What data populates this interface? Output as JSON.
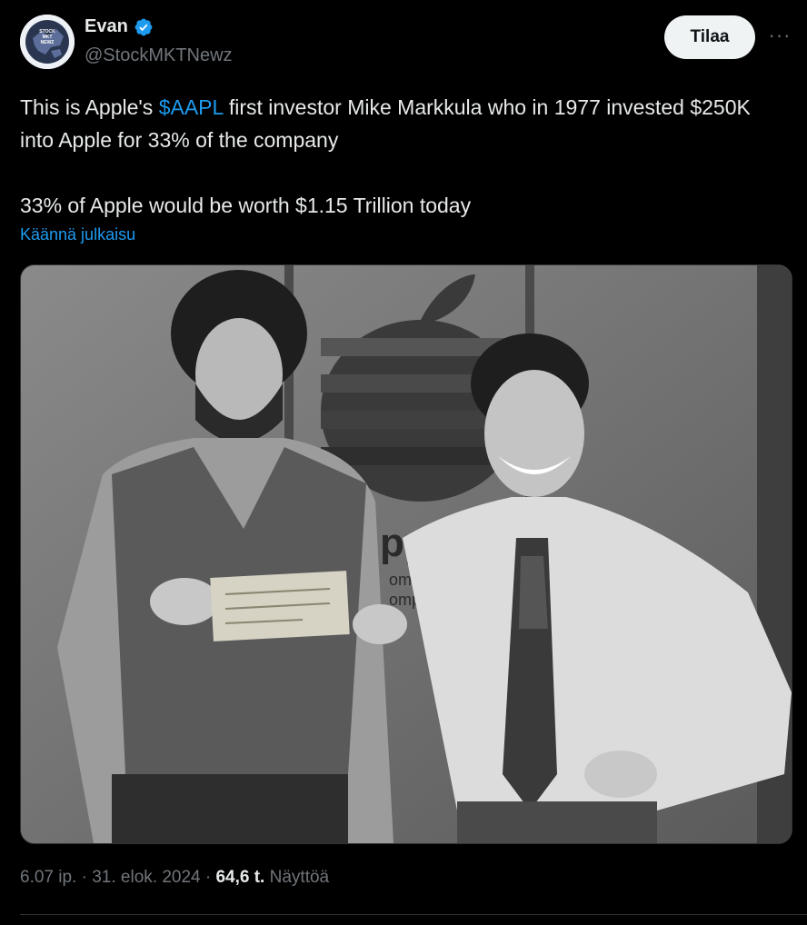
{
  "author": {
    "name": "Evan",
    "handle": "@StockMKTNewz",
    "avatar_text": "STOCK MKT NEWZ"
  },
  "actions": {
    "subscribe_label": "Tilaa",
    "more_label": "···"
  },
  "tweet": {
    "line1_before": "This is Apple's ",
    "cashtag": "$AAPL",
    "line1_after": " first investor Mike Markkula who in 1977 invested $250K into Apple for 33% of the company",
    "line2": "33% of Apple would be worth $1.15 Trillion today",
    "translate_label": "Käännä julkaisu"
  },
  "photo": {
    "logo_text": "pple",
    "logo_sub1": "ome/pc",
    "logo_sub2": "omput"
  },
  "footer": {
    "time_date": "6.07 ip. · 31. elok. 2024 · ",
    "views": "64,6 t.",
    "views_label": " Näyttöä"
  },
  "colors": {
    "link": "#1d9bf0",
    "text": "#e7e9ea",
    "muted": "#71767b",
    "verified": "#1d9bf0"
  }
}
